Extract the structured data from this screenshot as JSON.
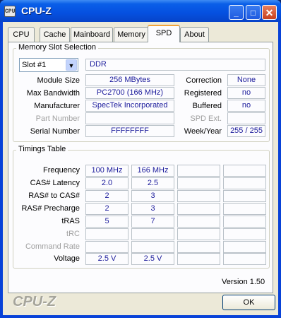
{
  "window": {
    "title": "CPU-Z",
    "icon": "cpu-z-app-icon",
    "icon_text": "CPU",
    "controls": {
      "minimize": "_",
      "maximize": "□",
      "close": "✕"
    }
  },
  "tabs": [
    {
      "label": "CPU",
      "active": false
    },
    {
      "label": "Cache",
      "active": false
    },
    {
      "label": "Mainboard",
      "active": false
    },
    {
      "label": "Memory",
      "active": false
    },
    {
      "label": "SPD",
      "active": true
    },
    {
      "label": "About",
      "active": false
    }
  ],
  "slot_group": {
    "title": "Memory Slot Selection",
    "slot_select": "Slot #1",
    "type": "DDR",
    "rows": [
      {
        "label": "Module Size",
        "value": "256 MBytes",
        "label2": "Correction",
        "value2": "None"
      },
      {
        "label": "Max Bandwidth",
        "value": "PC2700 (166 MHz)",
        "label2": "Registered",
        "value2": "no"
      },
      {
        "label": "Manufacturer",
        "value": "SpecTek Incorporated",
        "label2": "Buffered",
        "value2": "no"
      },
      {
        "label": "Part Number",
        "value": "",
        "label2": "SPD Ext.",
        "value2": ""
      },
      {
        "label": "Serial Number",
        "value": "FFFFFFFF",
        "label2": "Week/Year",
        "value2": "255 / 255"
      }
    ]
  },
  "timings_group": {
    "title": "Timings Table",
    "rows": [
      {
        "label": "Frequency",
        "values": [
          "100 MHz",
          "166 MHz",
          "",
          ""
        ]
      },
      {
        "label": "CAS# Latency",
        "values": [
          "2.0",
          "2.5",
          "",
          ""
        ]
      },
      {
        "label": "RAS# to CAS#",
        "values": [
          "2",
          "3",
          "",
          ""
        ]
      },
      {
        "label": "RAS# Precharge",
        "values": [
          "2",
          "3",
          "",
          ""
        ]
      },
      {
        "label": "tRAS",
        "values": [
          "5",
          "7",
          "",
          ""
        ]
      },
      {
        "label": "tRC",
        "values": [
          "",
          "",
          "",
          ""
        ]
      },
      {
        "label": "Command Rate",
        "values": [
          "",
          "",
          "",
          ""
        ]
      },
      {
        "label": "Voltage",
        "values": [
          "2.5 V",
          "2.5 V",
          "",
          ""
        ]
      }
    ]
  },
  "footer": {
    "brand": "CPU-Z",
    "version": "Version 1.50",
    "ok_label": "OK"
  },
  "colors": {
    "value_text": "#1c1c9c",
    "title_bar": "#0550e0",
    "active_tab_accent": "#f1a33a"
  }
}
